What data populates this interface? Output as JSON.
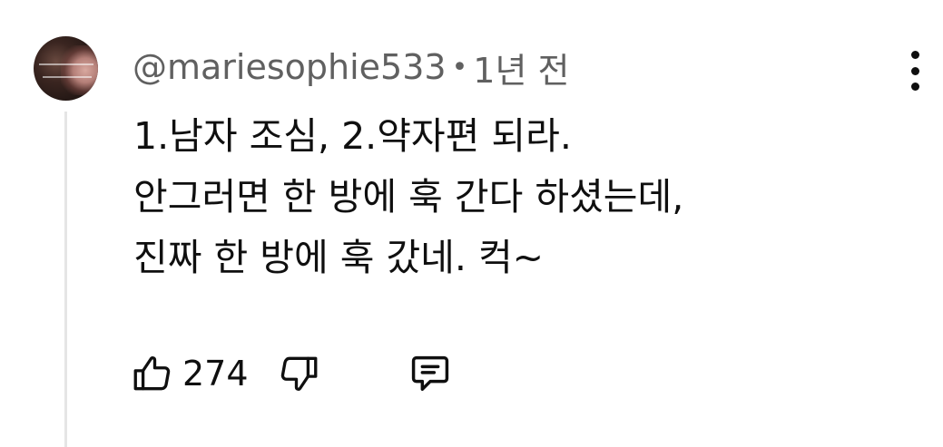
{
  "comment": {
    "author": "@mariesophie533",
    "separator": "•",
    "time": "1년 전",
    "lines": [
      "1.남자 조심, 2.약자편 되라.",
      "안그러면 한 방에 훅 간다 하셨는데,",
      "진짜 한 방에 훅 갔네. 컥~"
    ],
    "like_count": "274",
    "icons": {
      "like": "thumbs-up-icon",
      "dislike": "thumbs-down-icon",
      "reply": "reply-icon",
      "menu": "more-vertical-icon"
    },
    "colors": {
      "text": "#0f0f0f",
      "meta": "#606060",
      "thread_line": "#e5e5e5"
    }
  }
}
